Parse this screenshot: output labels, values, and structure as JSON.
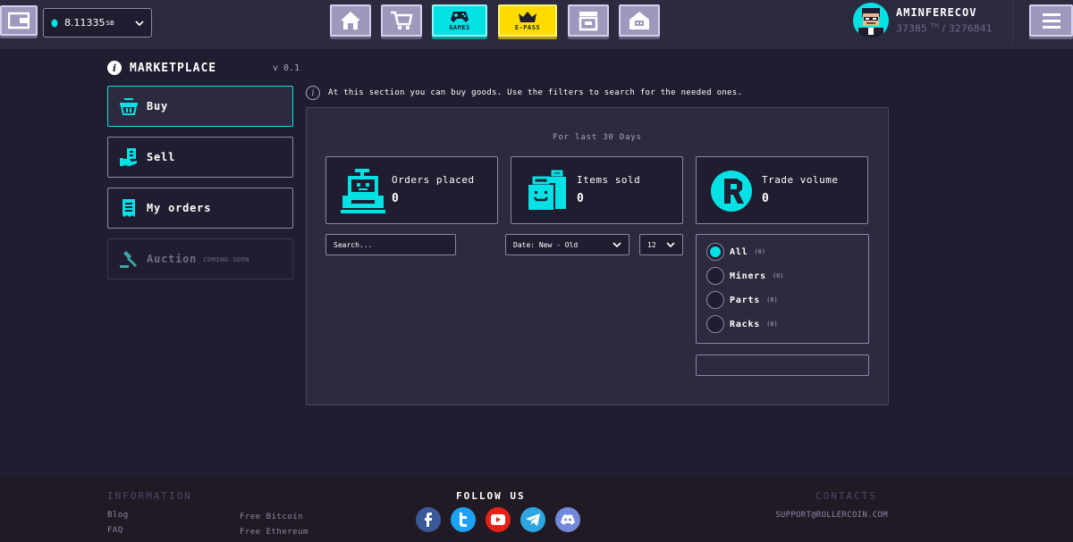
{
  "header": {
    "balance_value": "8.11335",
    "balance_unit": "SB",
    "nav": {
      "games_label": "GAMES",
      "epass_label": "E-PASS"
    },
    "profile": {
      "username": "AMINFERECOV",
      "power_value": "37385",
      "power_unit": "TH",
      "power_total": "/ 3276841"
    }
  },
  "sidebar": {
    "title": "MARKETPLACE",
    "version": "v 0.1",
    "items": [
      {
        "label": "Buy"
      },
      {
        "label": "Sell"
      },
      {
        "label": "My orders"
      },
      {
        "label": "Auction",
        "badge": "COMING SOON"
      }
    ]
  },
  "main": {
    "hint": "At this section you can buy goods. Use the filters to search for the needed ones.",
    "stats_title": "For last 30 Days",
    "stats": [
      {
        "label": "Orders placed",
        "value": "0"
      },
      {
        "label": "Items sold",
        "value": "0"
      },
      {
        "label": "Trade volume",
        "value": "0"
      }
    ],
    "search_placeholder": "Search...",
    "sort_value": "Date: New - Old",
    "per_page_value": "12",
    "filters": [
      {
        "label": "All",
        "count": "(0)"
      },
      {
        "label": "Miners",
        "count": "(0)"
      },
      {
        "label": "Parts",
        "count": "(0)"
      },
      {
        "label": "Racks",
        "count": "(0)"
      }
    ]
  },
  "footer": {
    "information_heading": "INFORMATION",
    "links_left": [
      "Blog",
      "FAQ"
    ],
    "links_right": [
      "Free Bitcoin",
      "Free Ethereum"
    ],
    "follow_heading": "FOLLOW US",
    "contacts_heading": "CONTACTS",
    "email": "SUPPORT@ROLLERCOIN.COM"
  },
  "colors": {
    "accent": "#03e1e4",
    "yellow": "#ffdc00",
    "background": "#1f1d2f",
    "panel": "#2b2a3f"
  }
}
